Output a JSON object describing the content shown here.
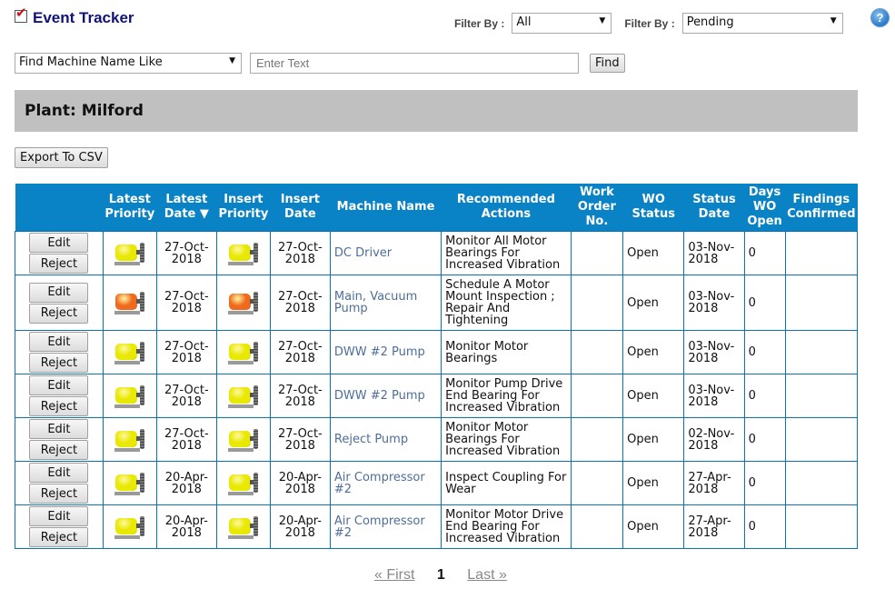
{
  "header": {
    "title": "Event Tracker",
    "filter1_label": "Filter By :",
    "filter1_value": "All",
    "filter2_label": "Filter By :",
    "filter2_value": "Pending",
    "help_icon": "?"
  },
  "search": {
    "field_select": "Find Machine Name Like",
    "placeholder": "Enter Text",
    "value": "",
    "find_label": "Find"
  },
  "plant": {
    "label": "Plant: Milford"
  },
  "toolbar": {
    "export_label": "Export To CSV"
  },
  "colors": {
    "header_bg": "#0a82c6",
    "priority_yellow": "#e8e800",
    "priority_orange": "#f06a1e",
    "link": "#4e6e9a"
  },
  "table": {
    "columns": [
      "",
      "Latest Priority",
      "Latest Date",
      "Insert Priority",
      "Insert Date",
      "Machine Name",
      "Recommended Actions",
      "Work Order No.",
      "WO Status",
      "Status Date",
      "Days WO Open",
      "Findings Confirmed"
    ],
    "sort_indicator": "▼",
    "edit_label": "Edit",
    "reject_label": "Reject",
    "rows": [
      {
        "latest_priority": "yellow",
        "latest_date": "27-Oct-2018",
        "insert_priority": "yellow",
        "insert_date": "27-Oct-2018",
        "machine": "DC Driver",
        "action": "Monitor All Motor Bearings For Increased Vibration",
        "wo_no": "",
        "wo_status": "Open",
        "status_date": "03-Nov-2018",
        "days_open": "0",
        "findings": ""
      },
      {
        "latest_priority": "orange",
        "latest_date": "27-Oct-2018",
        "insert_priority": "orange",
        "insert_date": "27-Oct-2018",
        "machine": "Main, Vacuum Pump",
        "action": "Schedule A Motor Mount Inspection ; Repair And Tightening",
        "wo_no": "",
        "wo_status": "Open",
        "status_date": "03-Nov-2018",
        "days_open": "0",
        "findings": ""
      },
      {
        "latest_priority": "yellow",
        "latest_date": "27-Oct-2018",
        "insert_priority": "yellow",
        "insert_date": "27-Oct-2018",
        "machine": "DWW #2 Pump",
        "action": "Monitor Motor Bearings",
        "wo_no": "",
        "wo_status": "Open",
        "status_date": "03-Nov-2018",
        "days_open": "0",
        "findings": ""
      },
      {
        "latest_priority": "yellow",
        "latest_date": "27-Oct-2018",
        "insert_priority": "yellow",
        "insert_date": "27-Oct-2018",
        "machine": "DWW #2 Pump",
        "action": "Monitor Pump Drive End Bearing For Increased Vibration",
        "wo_no": "",
        "wo_status": "Open",
        "status_date": "03-Nov-2018",
        "days_open": "0",
        "findings": ""
      },
      {
        "latest_priority": "yellow",
        "latest_date": "27-Oct-2018",
        "insert_priority": "yellow",
        "insert_date": "27-Oct-2018",
        "machine": "Reject Pump",
        "action": "Monitor Motor Bearings For Increased Vibration",
        "wo_no": "",
        "wo_status": "Open",
        "status_date": "02-Nov-2018",
        "days_open": "0",
        "findings": ""
      },
      {
        "latest_priority": "yellow",
        "latest_date": "20-Apr-2018",
        "insert_priority": "yellow",
        "insert_date": "20-Apr-2018",
        "machine": "Air Compressor #2",
        "action": "Inspect Coupling For Wear",
        "wo_no": "",
        "wo_status": "Open",
        "status_date": "27-Apr-2018",
        "days_open": "0",
        "findings": ""
      },
      {
        "latest_priority": "yellow",
        "latest_date": "20-Apr-2018",
        "insert_priority": "yellow",
        "insert_date": "20-Apr-2018",
        "machine": "Air Compressor #2",
        "action": "Monitor Motor Drive End Bearing For Increased Vibration",
        "wo_no": "",
        "wo_status": "Open",
        "status_date": "27-Apr-2018",
        "days_open": "0",
        "findings": ""
      }
    ]
  },
  "pager": {
    "first": "« First",
    "current": "1",
    "last": "Last »"
  }
}
